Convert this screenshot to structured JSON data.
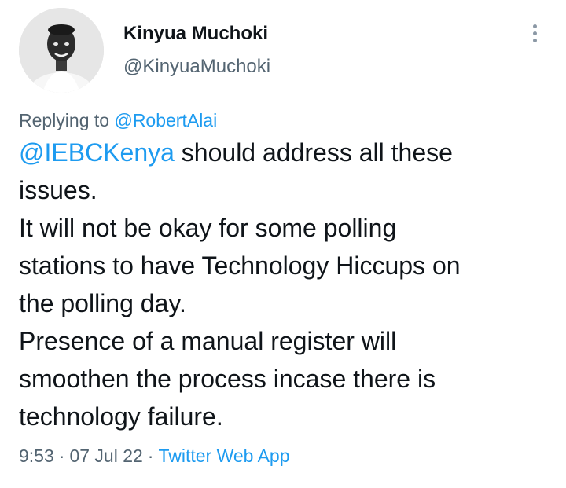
{
  "author": {
    "display_name": "Kinyua Muchoki",
    "handle": "@KinyuaMuchoki"
  },
  "reply": {
    "prefix": "Replying to",
    "to_handle": "@RobertAlai"
  },
  "tweet": {
    "mention": "@IEBCKenya",
    "lines": [
      " should address all these",
      "issues.",
      "It will not be okay for some polling",
      "stations to have Technology Hiccups on",
      "the polling day.",
      "Presence of a manual register will",
      "smoothen the process incase there is",
      "technology failure."
    ]
  },
  "meta": {
    "time": "9:53",
    "separator": "·",
    "date": "07 Jul 22",
    "source": "Twitter Web App"
  },
  "icons": {
    "more": "more-vertical-icon"
  },
  "colors": {
    "link": "#1d9bf0",
    "secondary_text": "#536471",
    "primary_text": "#0f1419",
    "background": "#ffffff"
  }
}
